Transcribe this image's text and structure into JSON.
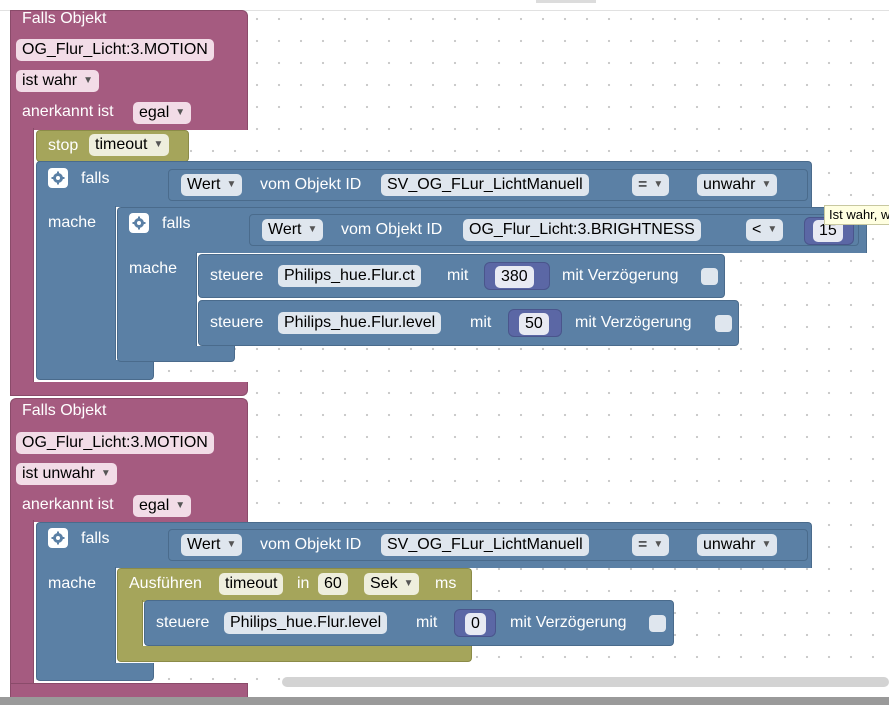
{
  "colors": {
    "event_block": "#a55b80",
    "logic_block": "#5b80a5",
    "timeout_block": "#a5a55b",
    "number_block": "#5b67a5",
    "tooltip_bg": "#ffffe1"
  },
  "event1": {
    "title": "Falls Objekt",
    "object_id": "OG_Flur_Licht:3.MOTION",
    "condition": "ist wahr",
    "ack_label": "anerkannt ist",
    "ack_value": "egal"
  },
  "stop": {
    "label": "stop",
    "target": "timeout"
  },
  "if1": {
    "falls": "falls",
    "mache": "mache",
    "cond": {
      "value_dd": "Wert",
      "from_label": "vom Objekt ID",
      "object_id": "SV_OG_FLur_LichtManuell",
      "op": "=",
      "compare": "unwahr"
    }
  },
  "if2": {
    "falls": "falls",
    "mache": "mache",
    "cond": {
      "value_dd": "Wert",
      "from_label": "vom Objekt ID",
      "object_id": "OG_Flur_Licht:3.BRIGHTNESS",
      "op": "<",
      "number": "15"
    },
    "tooltip": "Ist wahr, w"
  },
  "ctrl1": {
    "label": "steuere",
    "target": "Philips_hue.Flur.ct",
    "with": "mit",
    "value": "380",
    "delay": "mit Verzögerung"
  },
  "ctrl2": {
    "label": "steuere",
    "target": "Philips_hue.Flur.level",
    "with": "mit",
    "value": "50",
    "delay": "mit Verzögerung"
  },
  "event2": {
    "title": "Falls Objekt",
    "object_id": "OG_Flur_Licht:3.MOTION",
    "condition": "ist unwahr",
    "ack_label": "anerkannt ist",
    "ack_value": "egal"
  },
  "if3": {
    "falls": "falls",
    "mache": "mache",
    "cond": {
      "value_dd": "Wert",
      "from_label": "vom Objekt ID",
      "object_id": "SV_OG_FLur_LichtManuell",
      "op": "=",
      "compare": "unwahr"
    }
  },
  "timeout": {
    "label": "Ausführen",
    "name": "timeout",
    "in_label": "in",
    "delay": "60",
    "unit": "Sek",
    "ms_label": "ms"
  },
  "ctrl3": {
    "label": "steuere",
    "target": "Philips_hue.Flur.level",
    "with": "mit",
    "value": "0",
    "delay": "mit Verzögerung"
  },
  "icons": {
    "gear": "gear-icon",
    "dropdown": "chevron-down-icon",
    "checkbox": "checkbox-icon"
  }
}
